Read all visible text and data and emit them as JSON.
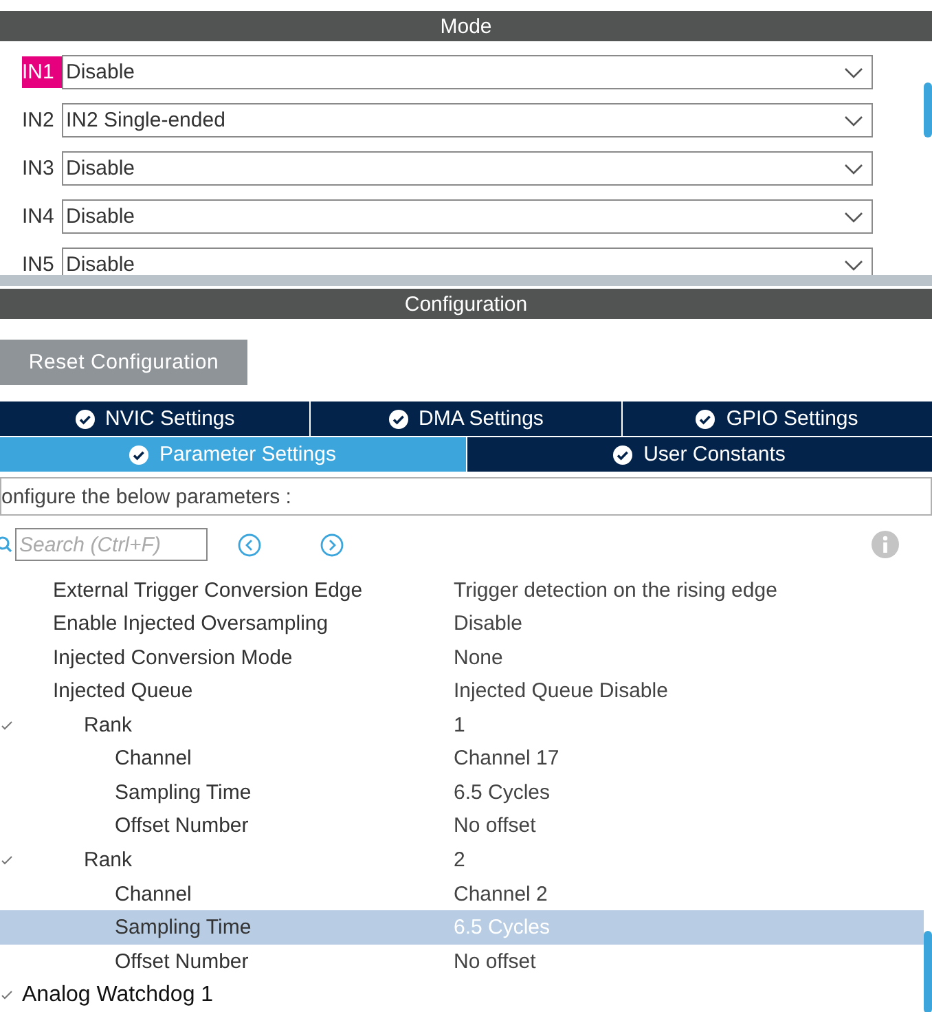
{
  "mode": {
    "title": "Mode",
    "inputs": [
      {
        "label": "IN1",
        "value": "Disable",
        "highlighted": true
      },
      {
        "label": "IN2",
        "value": "IN2 Single-ended",
        "highlighted": false
      },
      {
        "label": "IN3",
        "value": "Disable",
        "highlighted": false
      },
      {
        "label": "IN4",
        "value": "Disable",
        "highlighted": false
      },
      {
        "label": "IN5",
        "value": "Disable",
        "highlighted": false
      }
    ]
  },
  "configuration": {
    "title": "Configuration",
    "reset_button": "Reset Configuration",
    "tab_rows": [
      [
        {
          "label": "NVIC Settings",
          "selected": false
        },
        {
          "label": "DMA Settings",
          "selected": false
        },
        {
          "label": "GPIO Settings",
          "selected": false
        }
      ],
      [
        {
          "label": "Parameter Settings",
          "selected": true
        },
        {
          "label": "User Constants",
          "selected": false
        }
      ]
    ],
    "instruction": "onfigure the below parameters :",
    "search": {
      "placeholder": "Search (Ctrl+F)"
    },
    "tree": {
      "items": [
        {
          "label": "External Trigger Conversion Edge",
          "value": "Trigger detection on the rising edge",
          "selected": false
        },
        {
          "label": "Enable Injected Oversampling",
          "value": "Disable",
          "selected": false
        },
        {
          "label": "Injected Conversion Mode",
          "value": "None",
          "selected": false
        },
        {
          "label": "Injected Queue",
          "value": "Injected Queue Disable",
          "selected": false,
          "children": [
            {
              "label": "Rank",
              "value": "1",
              "selected": false,
              "expanded": true,
              "children": [
                {
                  "label": "Channel",
                  "value": "Channel 17",
                  "selected": false
                },
                {
                  "label": "Sampling Time",
                  "value": "6.5 Cycles",
                  "selected": false
                },
                {
                  "label": "Offset Number",
                  "value": "No offset",
                  "selected": false
                }
              ]
            },
            {
              "label": "Rank",
              "value": "2",
              "selected": false,
              "expanded": true,
              "children": [
                {
                  "label": "Channel",
                  "value": "Channel 2",
                  "selected": false
                },
                {
                  "label": "Sampling Time",
                  "value": "6.5 Cycles",
                  "selected": true
                },
                {
                  "label": "Offset Number",
                  "value": "No offset",
                  "selected": false
                }
              ]
            }
          ]
        }
      ],
      "after": [
        {
          "label": "Analog Watchdog 1",
          "expanded": true
        }
      ]
    }
  }
}
